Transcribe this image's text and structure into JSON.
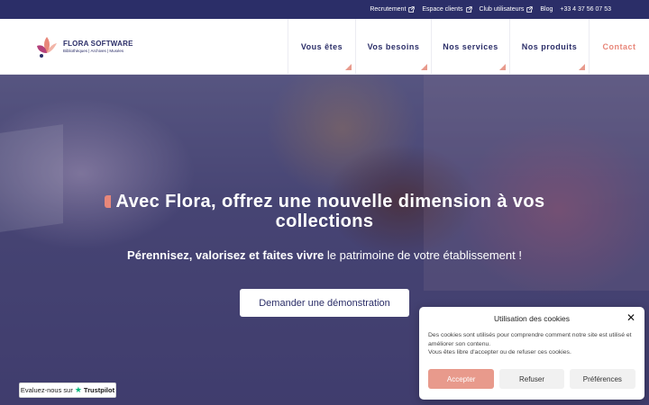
{
  "topbar": {
    "links": [
      {
        "label": "Recrutement",
        "external": true
      },
      {
        "label": "Espace clients",
        "external": true
      },
      {
        "label": "Club utilisateurs",
        "external": true
      },
      {
        "label": "Blog",
        "external": false
      },
      {
        "label": "+33 4 37 56 07 53",
        "external": false
      }
    ]
  },
  "logo": {
    "title": "FLORA SOFTWARE",
    "subtitle": "Bibliothèques | Archives | Musées"
  },
  "nav": {
    "items": [
      "Vous êtes",
      "Vos besoins",
      "Nos services",
      "Nos produits"
    ],
    "contact": "Contact"
  },
  "hero": {
    "title": "Avec Flora, offrez une nouvelle dimension à vos collections",
    "subtitle_bold": "Pérennisez, valorisez et faites vivre",
    "subtitle_rest": " le patrimoine de votre établissement !",
    "cta": "Demander une démonstration"
  },
  "trustpilot": {
    "prefix": "Evaluez-nous sur",
    "brand": "Trustpilot"
  },
  "cookie": {
    "title": "Utilisation des cookies",
    "text_line1": "Des cookies sont utilisés pour comprendre comment notre site est utilisé et améliorer son contenu.",
    "text_line2": "Vous êtes libre d'accepter ou de refuser ces cookies.",
    "accept": "Accepter",
    "refuse": "Refuser",
    "preferences": "Préférences"
  },
  "colors": {
    "navy": "#2b2e68",
    "accent": "#e8877a"
  },
  "icons": {
    "external": "external-link-icon",
    "close": "close-icon",
    "star": "star-icon"
  }
}
